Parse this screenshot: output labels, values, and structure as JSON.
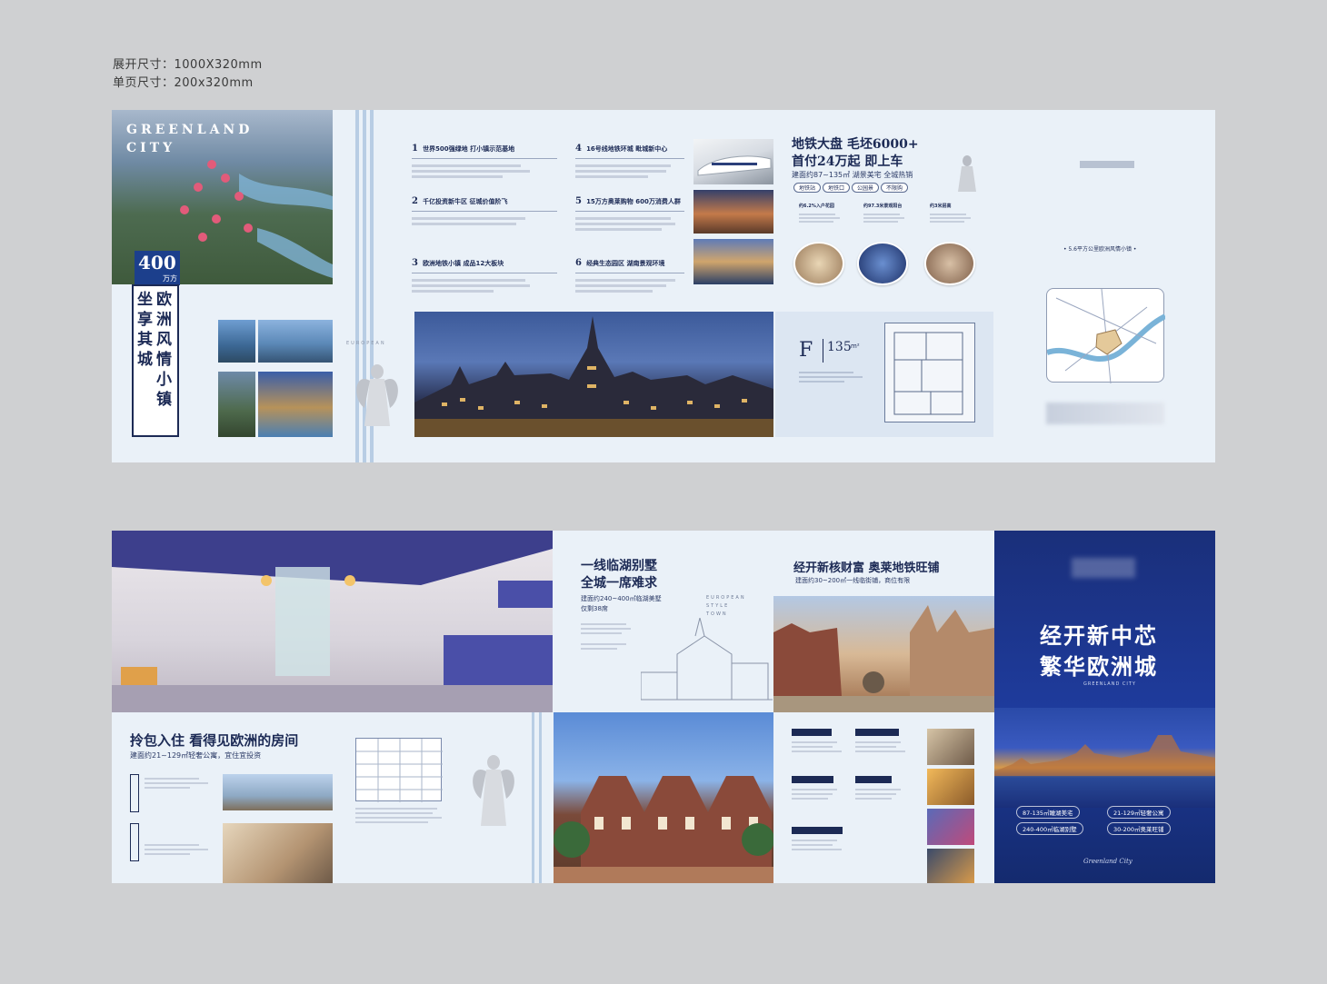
{
  "specs": {
    "spread": "展开尺寸：1000X320mm",
    "single": "单页尺寸：200x320mm"
  },
  "panel1": {
    "brand_line1": "GREENLAND",
    "brand_line2": "CITY",
    "price_num": "400",
    "price_unit": "万方",
    "slogan_col1": "坐享其城",
    "slogan_col2": "欧洲风情小镇",
    "features": [
      {
        "num": "1",
        "title": "世界500强绿地 打小镇示范基地"
      },
      {
        "num": "2",
        "title": "千亿投资新牛区 征城价值阶飞"
      },
      {
        "num": "3",
        "title": "欧洲地铁小镇 成品12大板块"
      },
      {
        "num": "4",
        "title": "16号线地铁环城 毗城新中心"
      },
      {
        "num": "5",
        "title": "15万方奥莱购物 600万消费人群"
      },
      {
        "num": "6",
        "title": "经典生态园区 湖南景观环境"
      }
    ],
    "headline1": "地铁大盘 毛坯6000+",
    "headline2": "首付24万起 即上车",
    "subline": "建面约87~135㎡ 湖景美宅 全城热销",
    "tags": [
      "地铁站",
      "地铁口",
      "公园景",
      "不限购"
    ],
    "amenities": [
      "约6.2%入户花园",
      "约97.3米景观阳台",
      "约3米层高"
    ],
    "floorplan_letter": "F",
    "floorplan_area": "135",
    "floorplan_unit": "m²",
    "map_caption": "• 5.6平方公里欧洲风情小镇 •",
    "europe_tag": "EUROPEAN"
  },
  "panel2": {
    "apt_title": "拎包入住 看得见欧洲的房间",
    "apt_sub": "建面约21~129㎡轻奢公寓，宜住宜投资",
    "villa_title1": "一线临湖别墅",
    "villa_title2": "全城一席难求",
    "villa_sub": "建面约240~400㎡临湖美墅",
    "villa_sub2": "仅剩38席",
    "shop_title": "经开新核财富 奥莱地铁旺铺",
    "shop_sub": "建面约30~200㎡一线临街铺，商位有限",
    "cover_title1": "经开新中芯",
    "cover_title2": "繁华欧洲城",
    "cover_small": "GREENLAND CITY",
    "cover_pills": [
      "87-135㎡瞰湖美宅",
      "21-129㎡轻奢公寓",
      "240-400㎡临湖别墅",
      "30-200㎡奥莱旺铺"
    ],
    "cover_sign": "Greenland City",
    "sketch_tag": "EUROPEAN STYLE TOWN"
  },
  "colors": {
    "navy": "#1c2a55",
    "panel_bg": "#eaf1f8",
    "cover_blue": "#1a3a8c",
    "accent_line": "#b8cde4"
  }
}
